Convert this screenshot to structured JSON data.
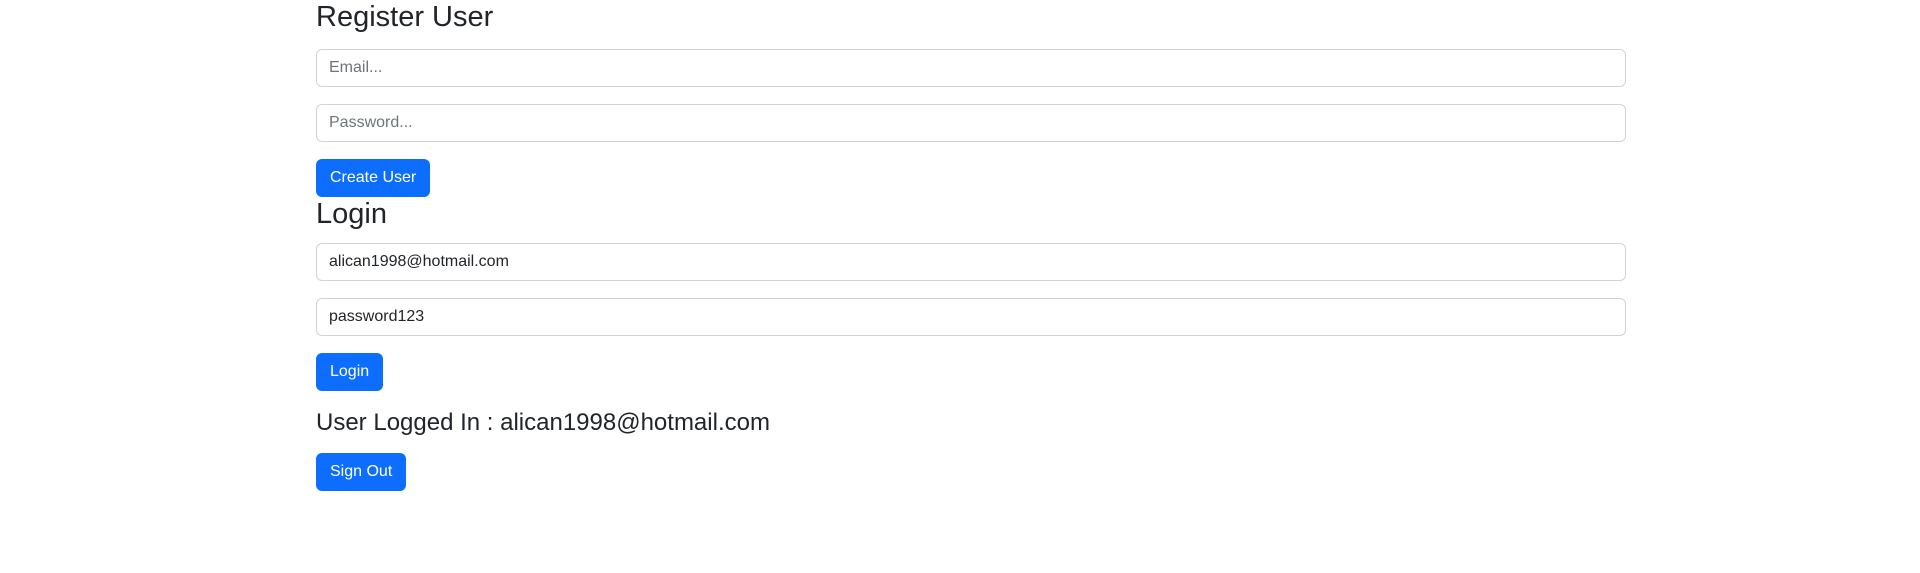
{
  "register": {
    "title": "Register User",
    "email_placeholder": "Email...",
    "email_value": "",
    "password_placeholder": "Password...",
    "password_value": "",
    "create_button_label": "Create User"
  },
  "login": {
    "title": "Login",
    "email_value": "alican1998@hotmail.com",
    "password_value": "password123",
    "login_button_label": "Login"
  },
  "session": {
    "status_text": "User Logged In : alican1998@hotmail.com",
    "signout_button_label": "Sign Out"
  },
  "colors": {
    "primary": "#0d6efd",
    "text": "#212529",
    "border": "#ced4da",
    "placeholder": "#6c757d"
  }
}
